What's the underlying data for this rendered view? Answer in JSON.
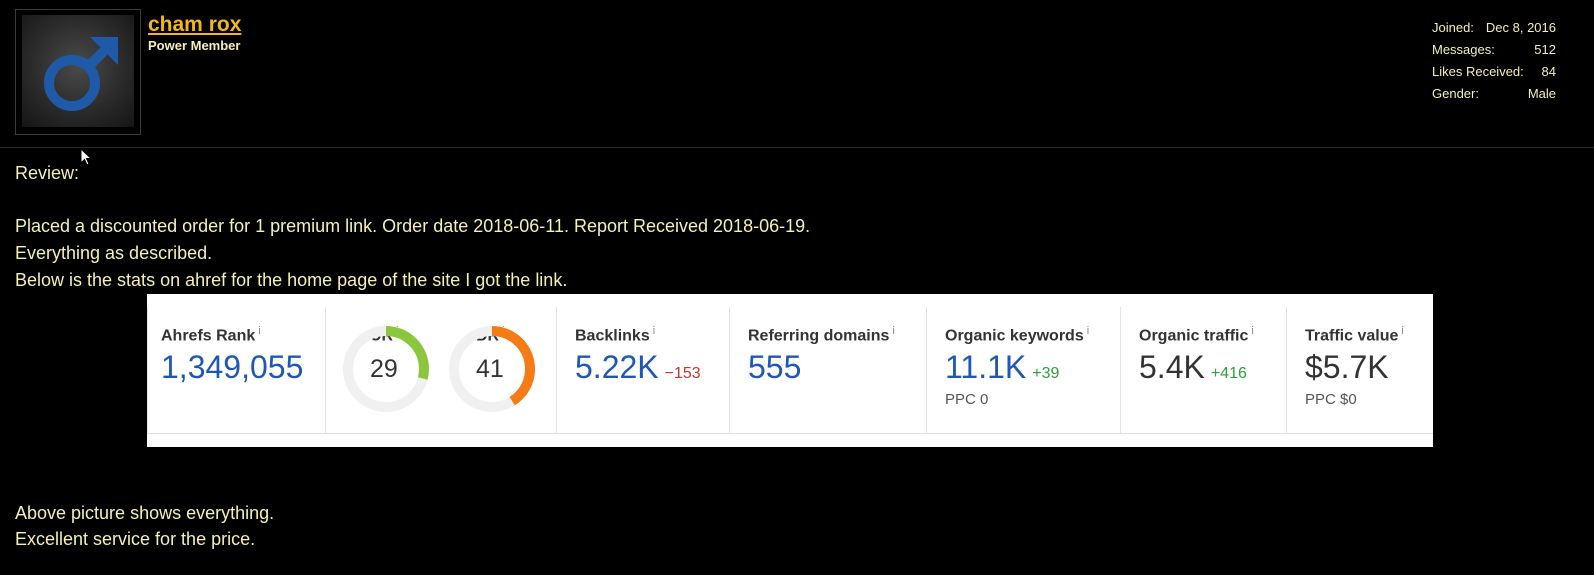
{
  "user": {
    "name": "cham rox",
    "title": "Power Member",
    "stats": [
      {
        "label": "Joined:",
        "value": "Dec 8, 2016"
      },
      {
        "label": "Messages:",
        "value": "512"
      },
      {
        "label": "Likes Received:",
        "value": "84"
      },
      {
        "label": "Gender:",
        "value": "Male"
      }
    ],
    "avatar_icon": "male-symbol-icon",
    "avatar_color": "#1f5aa8"
  },
  "post": {
    "heading": "Review:",
    "line1": "Placed a discounted order for 1 premium link. Order date 2018-06-11. Report Received 2018-06-19.",
    "line2": "Everything as described.",
    "line3": "Below is the stats on ahref for the home page of the site I got the link.",
    "line4": "Above picture shows everything.",
    "line5": "Excellent service for the price."
  },
  "ahrefs": {
    "info_mark": "i",
    "rank": {
      "label": "Ahrefs Rank",
      "value": "1,349,055"
    },
    "ur": {
      "label": "UR",
      "value": "29",
      "fill": 0.29,
      "color": "#8cc63f"
    },
    "dr": {
      "label": "DR",
      "value": "41",
      "fill": 0.41,
      "color": "#f47b16"
    },
    "backlinks": {
      "label": "Backlinks",
      "value": "5.22K",
      "delta": "−153"
    },
    "ref_domains": {
      "label": "Referring domains",
      "value": "555"
    },
    "organic_keywords": {
      "label": "Organic keywords",
      "value": "11.1K",
      "delta": "+39",
      "ppc": "PPC 0"
    },
    "organic_traffic": {
      "label": "Organic traffic",
      "value": "5.4K",
      "delta": "+416"
    },
    "traffic_value": {
      "label": "Traffic value",
      "value": "$5.7K",
      "ppc": "PPC $0"
    }
  }
}
